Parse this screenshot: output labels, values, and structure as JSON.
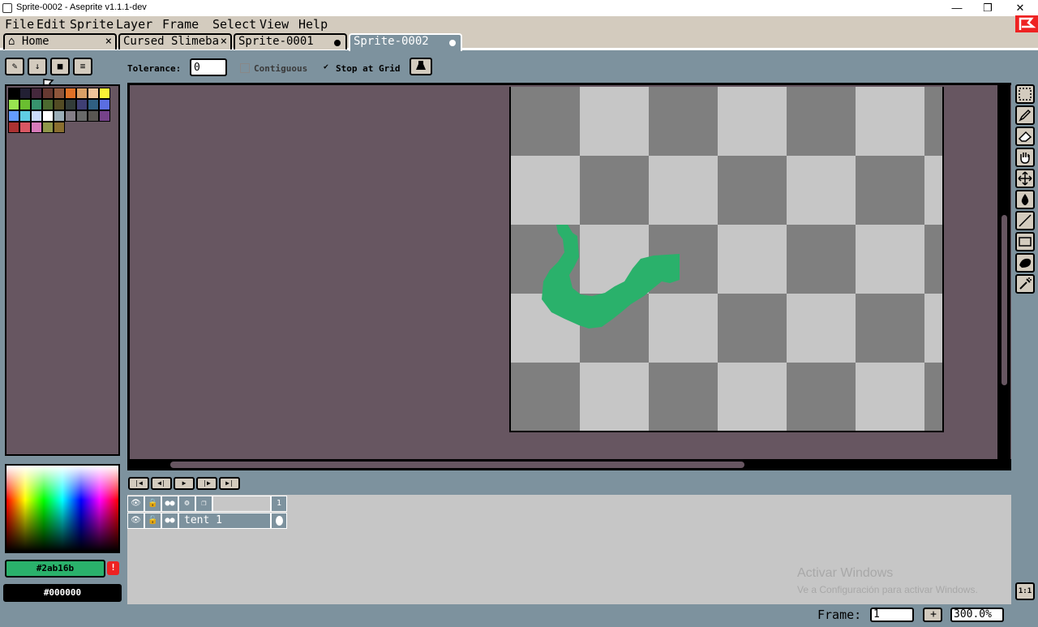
{
  "window": {
    "title": "Sprite-0002 - Aseprite v1.1.1-dev",
    "minimize_glyph": "—",
    "restore_glyph": "❐",
    "close_glyph": "✕"
  },
  "menu": [
    "File",
    "Edit",
    "Sprite",
    "Layer",
    "Frame",
    "Select",
    "View",
    "Help"
  ],
  "tabs": [
    {
      "label": "Home",
      "icon": "home-icon",
      "suffix": "×"
    },
    {
      "label": "Cursed Slimeba",
      "suffix": "×"
    },
    {
      "label": "Sprite-0001",
      "modified": true
    },
    {
      "label": "Sprite-0002",
      "modified": true,
      "active": true
    }
  ],
  "context_bar": {
    "tolerance_label": "Tolerance:",
    "tolerance_value": "0",
    "contiguous_label": "Contiguous",
    "contiguous_checked": false,
    "stop_at_grid_label": "Stop at Grid",
    "stop_at_grid_checked": true,
    "check_glyph": "✔"
  },
  "palette_buttons": [
    "pencil-icon",
    "arrow-down-icon",
    "folder-icon",
    "menu-icon"
  ],
  "palette_colors": [
    "#000000",
    "#222034",
    "#45283c",
    "#663931",
    "#8f563b",
    "#df7126",
    "#d9a066",
    "#eec39a",
    "#fbf236",
    "#99e550",
    "#6abe30",
    "#37946e",
    "#4b692f",
    "#524b24",
    "#323c39",
    "#3f3f74",
    "#306082",
    "#5b6ee1",
    "#639bff",
    "#5fcde4",
    "#cbdbfc",
    "#ffffff",
    "#9badb7",
    "#847e87",
    "#696a6a",
    "#595652",
    "#76428a",
    "#ac3232",
    "#d95763",
    "#d77bba",
    "#8f974a",
    "#8a6f30"
  ],
  "colors": {
    "foreground": "#2ab16b",
    "background": "#000000",
    "accent": "#7d929e",
    "editor_bg": "#675661"
  },
  "tools": [
    "rectangular-marquee-icon",
    "pencil-icon",
    "eraser-icon",
    "hand-icon",
    "move-icon",
    "paint-bucket-icon",
    "line-icon",
    "rectangle-icon",
    "contour-icon",
    "spray-icon"
  ],
  "animation_buttons": [
    "first-frame-icon",
    "previous-frame-icon",
    "play-icon",
    "next-frame-icon",
    "last-frame-icon"
  ],
  "timeline": {
    "frame_number": "1",
    "layer_name": "tent 1"
  },
  "watermark": {
    "title": "Activar Windows",
    "subtitle": "Ve a Configuración para activar Windows."
  },
  "status_bar": {
    "frame_label": "Frame:",
    "frame_value": "1",
    "add_frame_glyph": "+",
    "zoom_value": "300.0%",
    "zoom_reset_label": "1:1"
  }
}
